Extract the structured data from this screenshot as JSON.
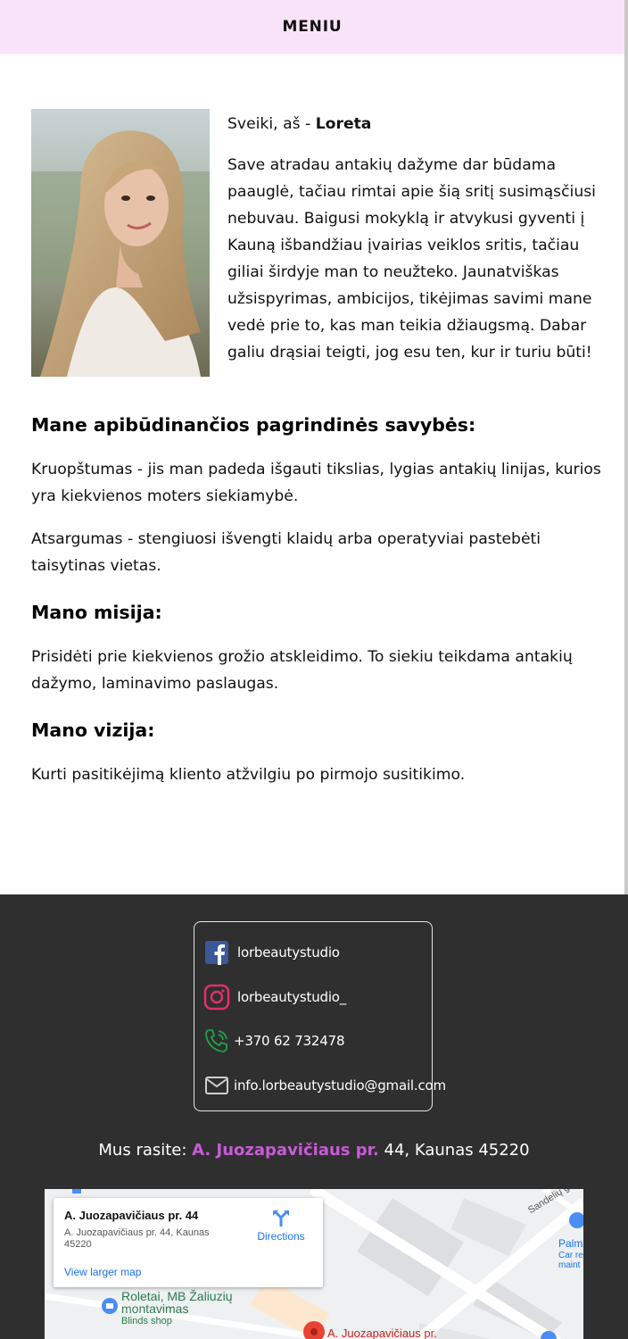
{
  "header": {
    "menu_label": "MENIU",
    "bg": "#f9e3f9"
  },
  "intro": {
    "greeting_prefix": "Sveiki, aš - ",
    "greeting_name": "Loreta",
    "story": "Save atradau antakių dažyme dar būdama paauglė, tačiau rimtai apie šią sritį susimąsčiusi nebuvau. Baigusi mokyklą ir atvykusi gyventi į Kauną išbandžiau įvairias veiklos sritis, tačiau giliai širdyje man to neužteko. Jaunatviškas užsispyrimas, ambicijos, tikėjimas savimi mane vedė prie to, kas man teikia džiaugsmą. Dabar galiu drąsiai teigti, jog esu ten, kur ir turiu būti!"
  },
  "traits": {
    "heading": "Mane apibūdinančios pagrindinės savybės:",
    "items": [
      "Kruopštumas - jis man padeda išgauti tikslias, lygias antakių linijas, kurios yra kiekvienos moters siekiamybė.",
      "Atsargumas - stengiuosi išvengti klaidų arba operatyviai pastebėti taisytinas vietas."
    ]
  },
  "mission": {
    "heading": "Mano misija:",
    "text": "Prisidėti prie kiekvienos grožio atskleidimo. To siekiu teikdama antakių dažymo, laminavimo paslaugas."
  },
  "vision": {
    "heading": "Mano vizija:",
    "text": "Kurti pasitikėjimą kliento atžvilgiu po pirmojo susitikimo."
  },
  "footer": {
    "bg": "#2f2f2f",
    "contacts": [
      {
        "icon": "facebook-icon",
        "label": "lorbeautystudio"
      },
      {
        "icon": "instagram-icon",
        "label": "lorbeautystudio_"
      },
      {
        "icon": "phone-icon",
        "label": "+370 62 732478"
      },
      {
        "icon": "mail-icon",
        "label": "info.lorbeautystudio@gmail.com"
      }
    ],
    "address_prefix": "Mus rasite: ",
    "address_street": "A. Juozapavičiaus pr.",
    "address_rest": " 44, Kaunas 45220",
    "accent": "#c95ad8"
  },
  "map": {
    "card_title": "A. Juozapavičiaus pr. 44",
    "card_address": "A. Juozapavičiaus pr. 44, Kaunas 45220",
    "directions_label": "Directions",
    "view_larger_label": "View larger map",
    "poi_1_name": "Roletai, MB Žaliuzių montavimas",
    "poi_1_type": "Blinds shop",
    "pin_label": "A. Juozapavičiaus pr.",
    "street_label": "Sandelių g.",
    "poi_2_name": "Palm",
    "poi_2_type": "Car re maint"
  }
}
